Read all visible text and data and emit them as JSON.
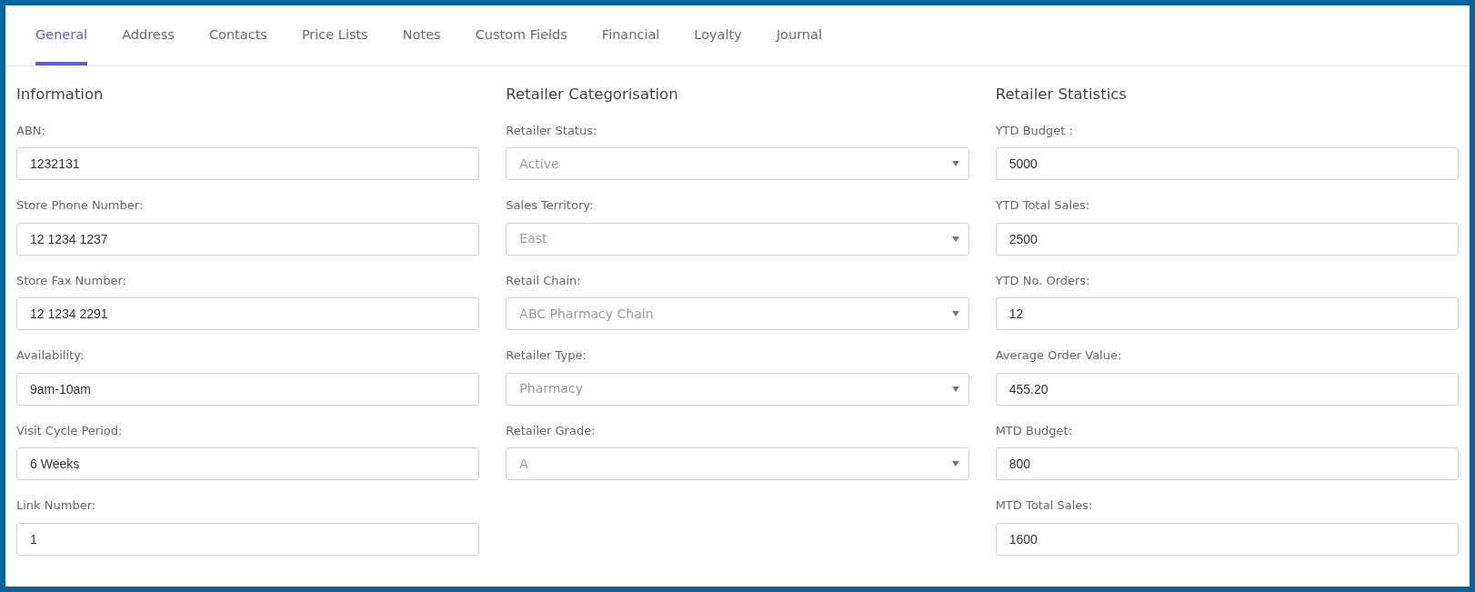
{
  "tabs": [
    {
      "label": "General",
      "selected": true
    },
    {
      "label": "Address",
      "selected": false
    },
    {
      "label": "Contacts",
      "selected": false
    },
    {
      "label": "Price Lists",
      "selected": false
    },
    {
      "label": "Notes",
      "selected": false
    },
    {
      "label": "Custom Fields",
      "selected": false
    },
    {
      "label": "Financial",
      "selected": false
    },
    {
      "label": "Loyalty",
      "selected": false
    },
    {
      "label": "Journal",
      "selected": false
    }
  ],
  "sections": [
    {
      "title": "Information",
      "fields": [
        {
          "kind": "text",
          "label": "ABN:",
          "value": "1232131"
        },
        {
          "kind": "text",
          "label": "Store Phone Number:",
          "value": "12 1234 1237"
        },
        {
          "kind": "text",
          "label": "Store Fax Number:",
          "value": "12 1234 2291"
        },
        {
          "kind": "text",
          "label": "Availability:",
          "value": "9am-10am"
        },
        {
          "kind": "text",
          "label": "Visit Cycle Period:",
          "value": "6 Weeks"
        },
        {
          "kind": "text",
          "label": "Link Number:",
          "value": "1"
        }
      ]
    },
    {
      "title": "Retailer Categorisation",
      "fields": [
        {
          "kind": "select",
          "label": "Retailer Status:",
          "value": "Active"
        },
        {
          "kind": "select",
          "label": "Sales Territory:",
          "value": "East"
        },
        {
          "kind": "select",
          "label": "Retail Chain:",
          "value": "ABC Pharmacy Chain"
        },
        {
          "kind": "select",
          "label": "Retailer Type:",
          "value": "Pharmacy"
        },
        {
          "kind": "select",
          "label": "Retailer Grade:",
          "value": "A"
        }
      ]
    },
    {
      "title": "Retailer Statistics",
      "fields": [
        {
          "kind": "text",
          "label": "YTD Budget :",
          "value": "5000"
        },
        {
          "kind": "text",
          "label": "YTD Total Sales:",
          "value": "2500"
        },
        {
          "kind": "text",
          "label": "YTD No. Orders:",
          "value": "12"
        },
        {
          "kind": "text",
          "label": "Average Order Value:",
          "value": "455.20"
        },
        {
          "kind": "text",
          "label": "MTD Budget:",
          "value": "800"
        },
        {
          "kind": "text",
          "label": "MTD Total Sales:",
          "value": "1600"
        }
      ]
    }
  ]
}
